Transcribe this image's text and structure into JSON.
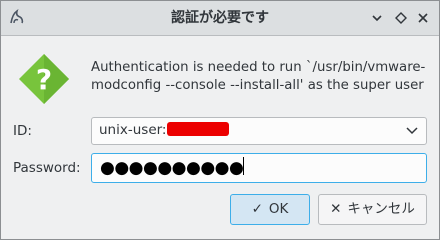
{
  "window": {
    "title": "認証が必要です"
  },
  "titlebar": {
    "min_icon": "chevron-down-icon",
    "max_icon": "diamond-restore-icon",
    "close_icon": "close-icon"
  },
  "dialog": {
    "icon": "question-icon",
    "message": "Authentication is needed to run `/usr/bin/vmware-modconfig --console --install-all' as the super user",
    "id_label": "ID:",
    "id_value": "unix-user:",
    "password_label": "Password:",
    "password_value": "●●●●●●●●●●"
  },
  "buttons": {
    "ok_label": "OK",
    "ok_icon": "checkmark-icon",
    "cancel_label": "キャンセル",
    "cancel_icon": "close-icon"
  },
  "colors": {
    "accent": "#3daee9",
    "warning": "#78c43c",
    "redaction": "#ec0000"
  }
}
